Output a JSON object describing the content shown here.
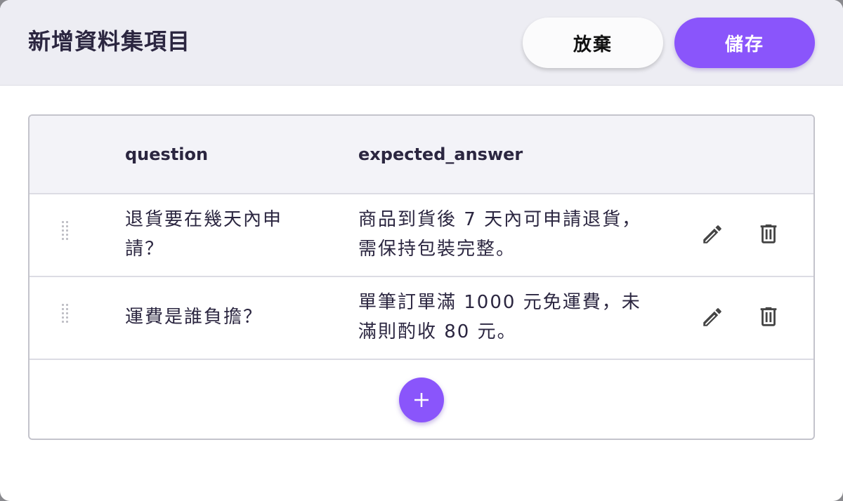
{
  "dialog": {
    "title": "新增資料集項目",
    "discard_label": "放棄",
    "save_label": "儲存"
  },
  "table": {
    "columns": [
      "question",
      "expected_answer"
    ],
    "rows": [
      {
        "question_lines": [
          "退貨要在幾天內申",
          "請？"
        ],
        "answer_lines": [
          "商品到貨後 7 天內可申請退貨，",
          "需保持包裝完整。"
        ]
      },
      {
        "question_lines": [
          "運費是誰負擔？"
        ],
        "answer_lines": [
          "單筆訂單滿 1000 元免運費，未",
          "滿則酌收 80 元。"
        ]
      }
    ]
  },
  "icons": {
    "drag": "drag-handle-icon",
    "edit": "pencil-icon",
    "delete": "trash-icon",
    "add": "plus-icon"
  },
  "colors": {
    "accent": "#8a55fb",
    "header_bg": "#ededf3",
    "table_header_bg": "#f3f3f8",
    "text": "#2b2640",
    "icon": "#444444"
  }
}
